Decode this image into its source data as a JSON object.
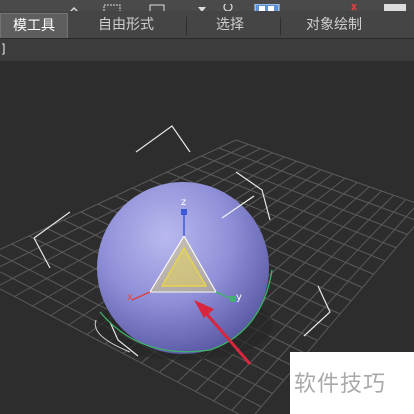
{
  "tabs": [
    {
      "label": "模工具",
      "active": true
    },
    {
      "label": "自由形式",
      "active": false
    },
    {
      "label": "选择",
      "active": false
    },
    {
      "label": "对象绘制",
      "active": false
    }
  ],
  "viewport": {
    "label_bracket": "]",
    "gizmo_labels": {
      "z": "z",
      "x": "x",
      "y": "y"
    }
  },
  "colors": {
    "sphere": "#8f8fd8",
    "grid": "#5a5a5a",
    "arrow": "#d7263d",
    "gizmo_yellow": "#e8d44d",
    "axis_x": "#d84040",
    "axis_y": "#3fb36a",
    "axis_z": "#3c5ad8"
  },
  "watermark": {
    "text": "软件技巧"
  },
  "toolbar": {
    "icons": [
      "move-icon",
      "select-region-icon",
      "link-icon",
      "rotate-icon",
      "viewport-layout-icon",
      "tab-close-icon",
      "settings-icon"
    ]
  }
}
